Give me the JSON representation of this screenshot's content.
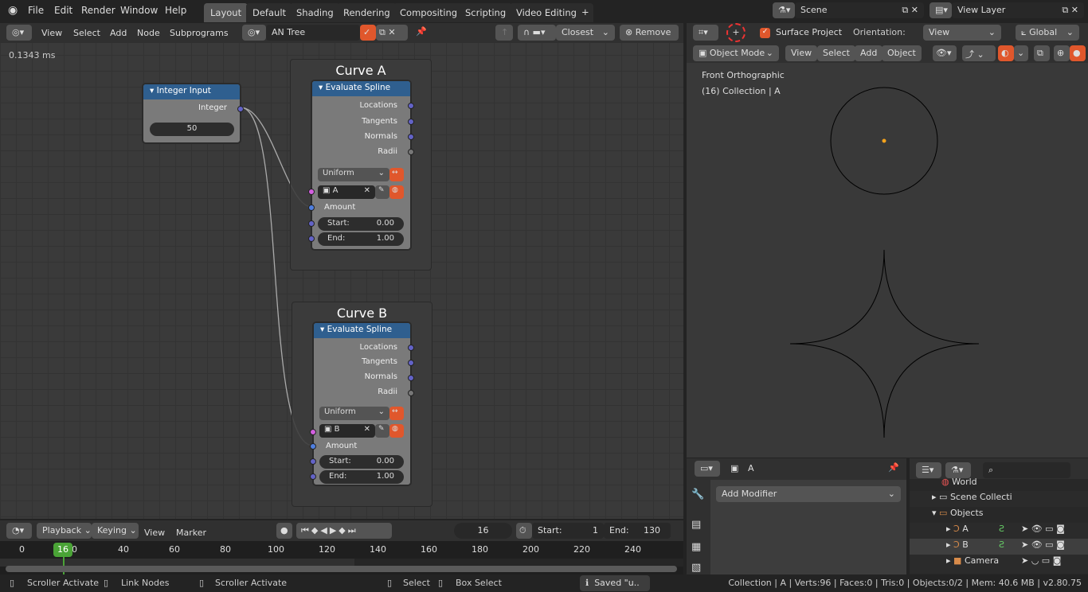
{
  "topbar": {
    "menus": [
      "File",
      "Edit",
      "Render",
      "Window",
      "Help"
    ],
    "tabs": [
      "Layout",
      "Default",
      "Shading",
      "Rendering",
      "Compositing",
      "Scripting",
      "Video Editing"
    ],
    "active_tab": "Layout",
    "add_tab": "+",
    "scene": "Scene",
    "view_layer": "View Layer"
  },
  "node_header": {
    "menus": [
      "View",
      "Select",
      "Add",
      "Node",
      "Subprograms"
    ],
    "tree": "AN Tree",
    "snap": "Closest",
    "remove": "Remove"
  },
  "node_editor": {
    "timing": "0.1343 ms",
    "integer_node": {
      "title": "Integer Input",
      "output": "Integer",
      "value": "50"
    },
    "frames": [
      {
        "title": "Curve A",
        "node_title": "Evaluate Spline",
        "outputs": [
          "Locations",
          "Tangents",
          "Normals",
          "Radii"
        ],
        "mode": "Uniform",
        "object": "A",
        "amount": "Amount",
        "start_label": "Start:",
        "start": "0.00",
        "end_label": "End:",
        "end": "1.00"
      },
      {
        "title": "Curve B",
        "node_title": "Evaluate Spline",
        "outputs": [
          "Locations",
          "Tangents",
          "Normals",
          "Radii"
        ],
        "mode": "Uniform",
        "object": "B",
        "amount": "Amount",
        "start_label": "Start:",
        "start": "0.00",
        "end_label": "End:",
        "end": "1.00"
      }
    ]
  },
  "viewport": {
    "surface_project": "Surface Project",
    "orientation_label": "Orientation:",
    "orientation": "View",
    "transform": "Global",
    "mode": "Object Mode",
    "menus": [
      "View",
      "Select",
      "Add",
      "Object"
    ],
    "view_name": "Front Orthographic",
    "collection": "(16) Collection | A"
  },
  "properties": {
    "object": "A",
    "add_modifier": "Add Modifier"
  },
  "outliner": {
    "rows": [
      "World",
      "Scene Collecti",
      "Objects",
      "A",
      "B",
      "Camera"
    ]
  },
  "timeline": {
    "menus": [
      "Playback",
      "Keying",
      "View",
      "Marker"
    ],
    "current_frame": "16",
    "start_label": "Start:",
    "start": "1",
    "end_label": "End:",
    "end": "130",
    "ticks": [
      "0",
      "40",
      "60",
      "80",
      "100",
      "120",
      "140",
      "160",
      "180",
      "200",
      "220",
      "240"
    ]
  },
  "status": {
    "items": [
      "Scroller Activate",
      "Link Nodes",
      "Scroller Activate",
      "Select",
      "Box Select"
    ],
    "saved": "Saved \"u..",
    "stats": "Collection | A | Verts:96 | Faces:0 | Tris:0 | Objects:0/2 | Mem: 40.6 MB | v2.80.75"
  },
  "colors": {
    "accent": "#e0572c",
    "node_header": "#2f5f8f",
    "frame_indicator": "#4aa336"
  }
}
